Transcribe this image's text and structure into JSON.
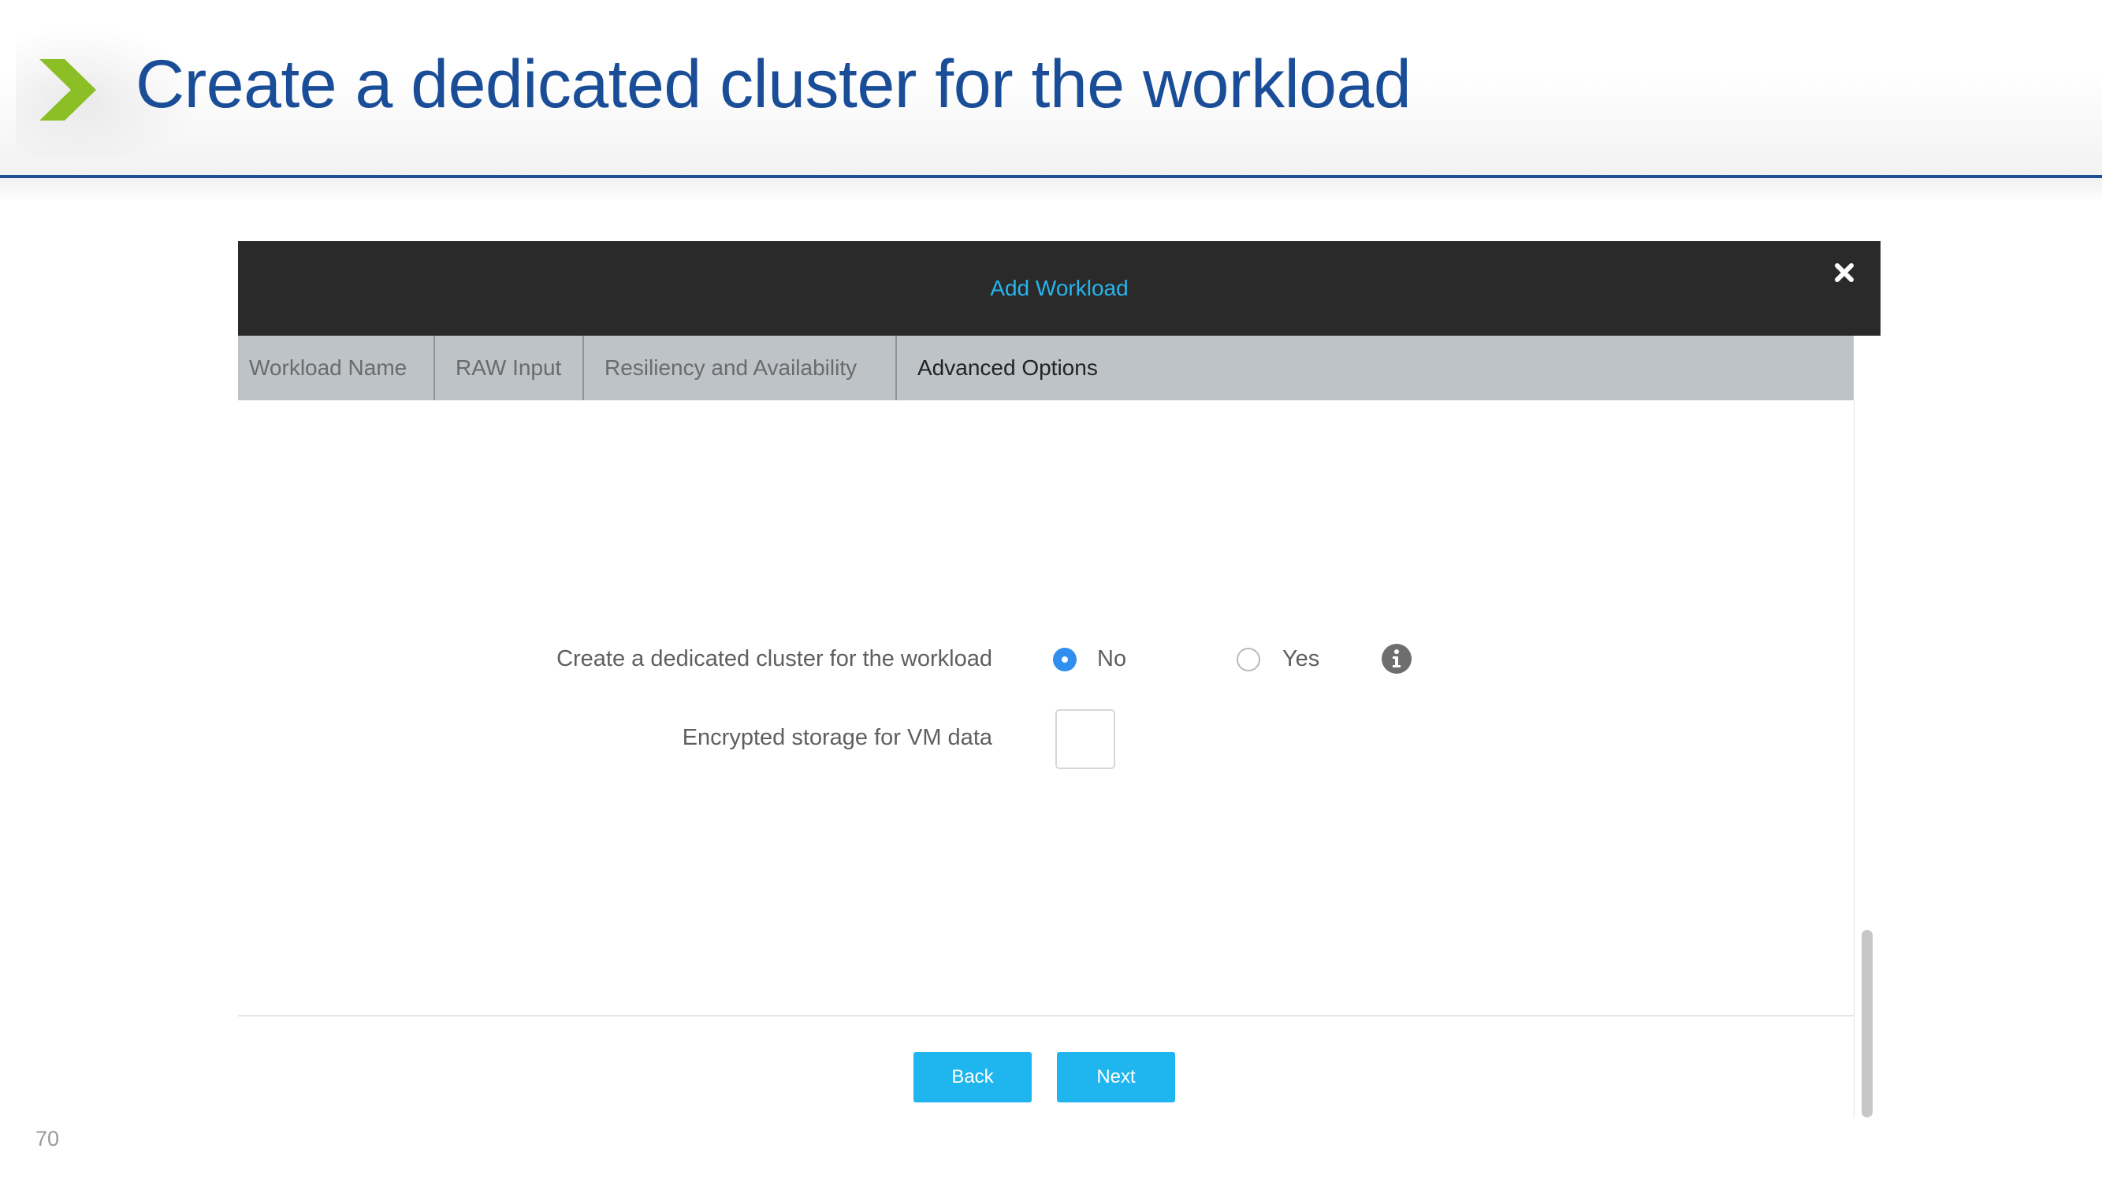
{
  "slide": {
    "title": "Create a dedicated cluster for the workload",
    "page_number": "70",
    "accent_color": "#8cbf26",
    "title_color": "#1a4d97"
  },
  "modal": {
    "title": "Add Workload",
    "close_icon": "close-icon",
    "tabs": [
      {
        "label": "Workload Name",
        "active": false
      },
      {
        "label": "RAW Input",
        "active": false
      },
      {
        "label": "Resiliency and Availability",
        "active": false
      },
      {
        "label": "Advanced Options",
        "active": true
      }
    ],
    "form": {
      "dedicated_cluster": {
        "label": "Create a dedicated cluster for the workload",
        "options": [
          {
            "label": "No",
            "selected": true
          },
          {
            "label": "Yes",
            "selected": false
          }
        ],
        "info_icon": "info-icon"
      },
      "encrypted_storage": {
        "label": "Encrypted storage for VM data",
        "checked": false
      }
    },
    "buttons": {
      "back": "Back",
      "next": "Next"
    },
    "button_color": "#1fb6ef",
    "title_color": "#26b5ec"
  }
}
